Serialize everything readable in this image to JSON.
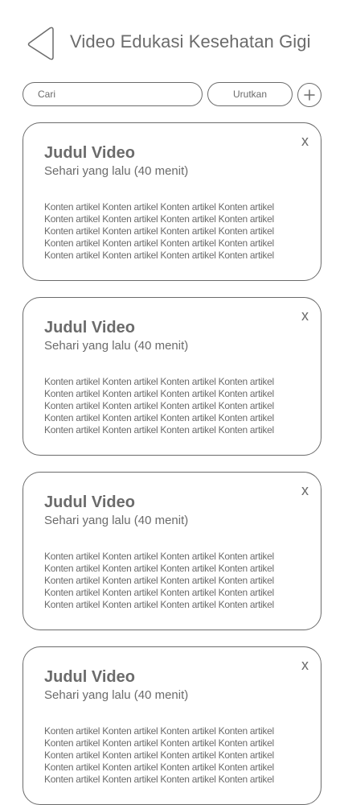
{
  "header": {
    "title": "Video Edukasi Kesehatan Gigi",
    "back_icon": "chevron-left-icon"
  },
  "toolbar": {
    "search_placeholder": "Cari",
    "sort_label": "Urutkan",
    "add_icon": "plus-icon"
  },
  "colors": {
    "text": "#6b6b6b",
    "border": "#6b6b6b",
    "background": "#ffffff"
  },
  "cards": [
    {
      "title": "Judul Video",
      "meta": "Sehari yang lalu (40 menit)",
      "close_label": "x",
      "body": "Konten artikel Konten artikel Konten artikel Konten artikel Konten artikel Konten artikel Konten artikel Konten artikel Konten artikel Konten artikel Konten artikel Konten artikel Konten artikel Konten artikel Konten artikel Konten artikel Konten artikel Konten artikel Konten artikel Konten artikel"
    },
    {
      "title": "Judul Video",
      "meta": "Sehari yang lalu (40 menit)",
      "close_label": "x",
      "body": "Konten artikel Konten artikel Konten artikel Konten artikel Konten artikel Konten artikel Konten artikel Konten artikel Konten artikel Konten artikel Konten artikel Konten artikel Konten artikel Konten artikel Konten artikel Konten artikel Konten artikel Konten artikel Konten artikel Konten artikel"
    },
    {
      "title": "Judul Video",
      "meta": "Sehari yang lalu (40 menit)",
      "close_label": "x",
      "body": "Konten artikel Konten artikel Konten artikel Konten artikel Konten artikel Konten artikel Konten artikel Konten artikel Konten artikel Konten artikel Konten artikel Konten artikel Konten artikel Konten artikel Konten artikel Konten artikel Konten artikel Konten artikel Konten artikel Konten artikel"
    },
    {
      "title": "Judul Video",
      "meta": "Sehari yang lalu (40 menit)",
      "close_label": "x",
      "body": "Konten artikel Konten artikel Konten artikel Konten artikel Konten artikel Konten artikel Konten artikel Konten artikel Konten artikel Konten artikel Konten artikel Konten artikel Konten artikel Konten artikel Konten artikel Konten artikel Konten artikel Konten artikel Konten artikel Konten artikel"
    }
  ]
}
